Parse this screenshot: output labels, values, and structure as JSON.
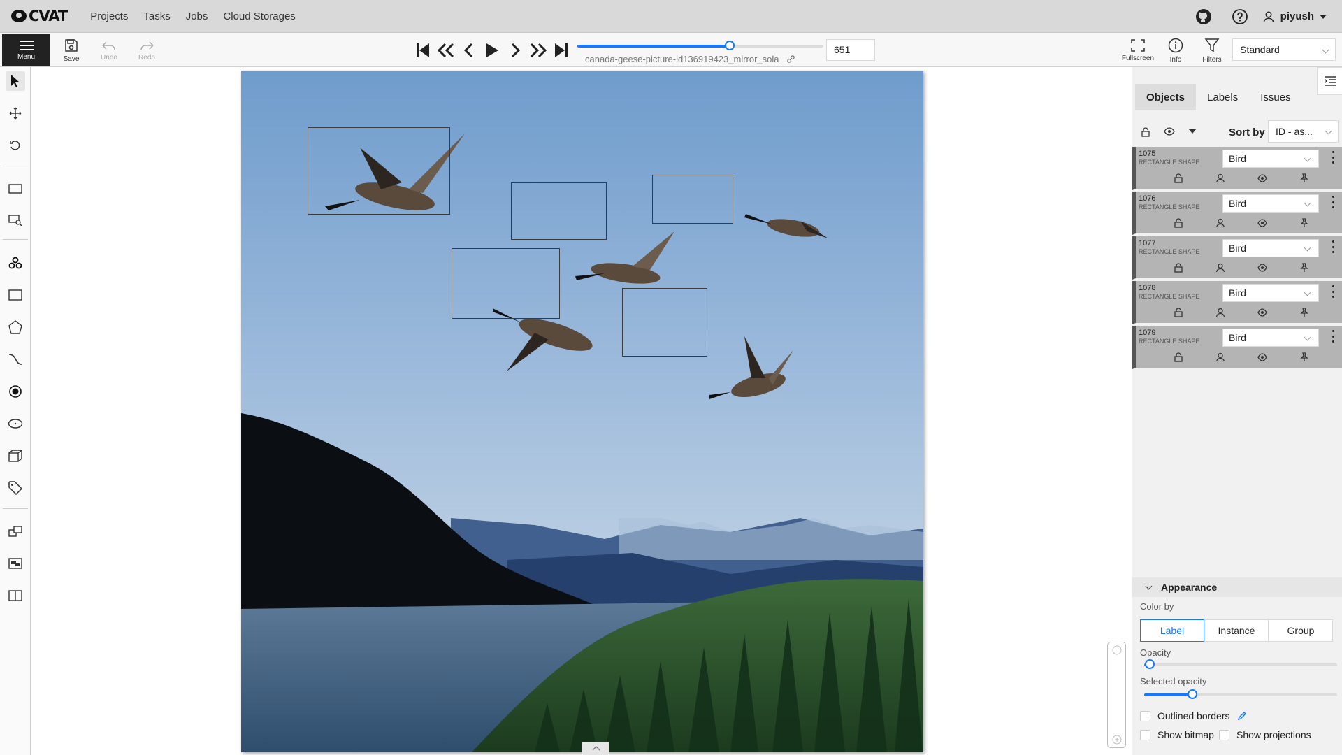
{
  "app": {
    "name": "CVAT"
  },
  "nav": {
    "projects": "Projects",
    "tasks": "Tasks",
    "jobs": "Jobs",
    "cloud": "Cloud Storages"
  },
  "user": {
    "name": "piyush"
  },
  "toolbar": {
    "menu": "Menu",
    "save": "Save",
    "undo": "Undo",
    "redo": "Redo",
    "filename": "canada-geese-picture-id136919423_mirror_sola",
    "frame": "651",
    "frame_progress": 0.62,
    "fullscreen": "Fullscreen",
    "info": "Info",
    "filters": "Filters",
    "workspace": "Standard"
  },
  "sidebar": {
    "tabs": [
      "Objects",
      "Labels",
      "Issues"
    ],
    "sort_by": "Sort by",
    "sort_value": "ID - as...",
    "objects": [
      {
        "id": "1075",
        "type": "RECTANGLE SHAPE",
        "label": "Bird"
      },
      {
        "id": "1076",
        "type": "RECTANGLE SHAPE",
        "label": "Bird"
      },
      {
        "id": "1077",
        "type": "RECTANGLE SHAPE",
        "label": "Bird"
      },
      {
        "id": "1078",
        "type": "RECTANGLE SHAPE",
        "label": "Bird"
      },
      {
        "id": "1079",
        "type": "RECTANGLE SHAPE",
        "label": "Bird"
      }
    ]
  },
  "appearance": {
    "title": "Appearance",
    "color_by": "Color by",
    "options": [
      "Label",
      "Instance",
      "Group"
    ],
    "selected": "Label",
    "opacity": "Opacity",
    "opacity_value": 0.03,
    "selected_opacity": "Selected opacity",
    "selected_opacity_value": 0.25,
    "outlined_borders": "Outlined borders",
    "show_bitmap": "Show bitmap",
    "show_projections": "Show projections"
  }
}
